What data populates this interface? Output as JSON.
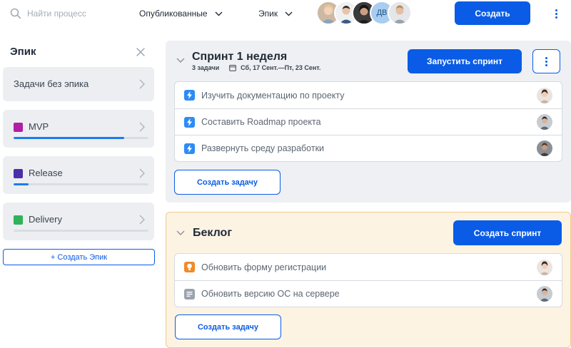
{
  "search": {
    "placeholder": "Найти процесс",
    "icon": "search-icon"
  },
  "filters": {
    "status": "Опубликованные",
    "group": "Эпик"
  },
  "avatars": {
    "initials": "ДВ"
  },
  "header": {
    "create_label": "Создать"
  },
  "colors": {
    "accent": "#0a5ce6",
    "panel_bg": "#eef0f3",
    "backlog_bg": "#fdf3e3",
    "backlog_border": "#f3c98a",
    "task_blue": "#2d8cf5",
    "task_orange": "#f08a2a",
    "task_gray": "#9aa3ae"
  },
  "epic_panel": {
    "title": "Эпик",
    "items": [
      {
        "label": "Задачи без эпика"
      },
      {
        "label": "MVP",
        "color": "#b11fa6",
        "progress": 0.82
      },
      {
        "label": "Release",
        "color": "#4a2fa8",
        "progress": 0.11
      },
      {
        "label": "Delivery",
        "color": "#2fb35a",
        "progress": 0
      }
    ],
    "create_label": "+  Создать Эпик"
  },
  "sprint": {
    "title": "Спринт 1 неделя",
    "count": "3 задачи",
    "dates": "Сб, 17 Сент.—Пт, 23 Сент.",
    "start_label": "Запустить спринт",
    "tasks": [
      {
        "title": "Изучить документацию по проекту",
        "type": "lightning-icon"
      },
      {
        "title": "Составить Roadmap проекта",
        "type": "lightning-icon"
      },
      {
        "title": "Развернуть среду разработки",
        "type": "lightning-icon"
      }
    ],
    "create_task_label": "Создать задачу"
  },
  "backlog": {
    "title": "Беклог",
    "create_sprint_label": "Создать спринт",
    "tasks": [
      {
        "title": "Обновить форму регистрации",
        "type": "idea-icon"
      },
      {
        "title": "Обновить версию ОС на сервере",
        "type": "document-icon"
      }
    ],
    "create_task_label": "Создать задачу"
  }
}
